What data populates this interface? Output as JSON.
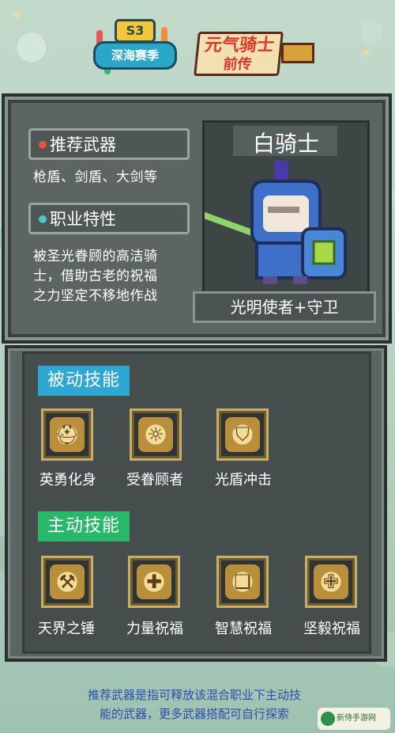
{
  "header": {
    "season_badge": "S3",
    "season_name": "深海赛季",
    "game_title_line1": "元气骑士",
    "game_title_line2": "前传"
  },
  "character": {
    "recommend_label": "推荐武器",
    "recommend_value": "枪盾、剑盾、大剑等",
    "trait_label": "职业特性",
    "trait_line1": "被圣光眷顾的高洁骑",
    "trait_line2": "士，借助古老的祝福",
    "trait_line3": "之力坚定不移地作战",
    "name": "白骑士",
    "role": "光明使者+守卫",
    "colors": {
      "recommend_dot": "#e8523a",
      "trait_dot": "#4ec7c9"
    }
  },
  "skills": {
    "passive_label": "被动技能",
    "active_label": "主动技能",
    "passive": [
      {
        "name": "英勇化身",
        "icon": "helmet-icon"
      },
      {
        "name": "受眷顾者",
        "icon": "blessed-helmet-icon"
      },
      {
        "name": "光盾冲击",
        "icon": "shield-strike-icon"
      }
    ],
    "active": [
      {
        "name": "天界之锤",
        "icon": "hammer-icon"
      },
      {
        "name": "力量祝福",
        "icon": "hammer-blessing-icon"
      },
      {
        "name": "智慧祝福",
        "icon": "book-blessing-icon"
      },
      {
        "name": "坚毅祝福",
        "icon": "shield-blessing-icon"
      }
    ],
    "colors": {
      "passive_tab": "#2ea8d2",
      "active_tab": "#29b86a",
      "icon_frame": "#c7ad6a"
    }
  },
  "footer": {
    "note_line1": "推荐武器是指可释放该混合职业下主动技",
    "note_line2": "能的武器，更多武器搭配可自行探索",
    "watermark": "新侍手游网"
  }
}
